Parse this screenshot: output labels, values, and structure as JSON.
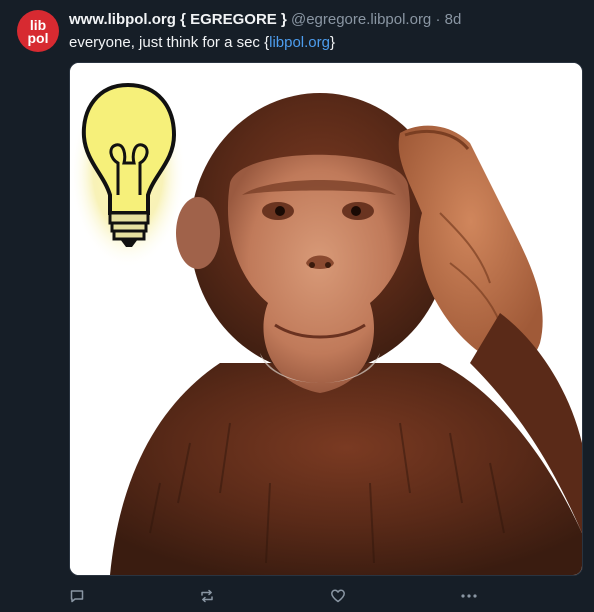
{
  "post": {
    "author": {
      "display_name": "www.libpol.org { EGREGORE }",
      "handle": "@egregore.libpol.org",
      "avatar_text_top": "lib",
      "avatar_text_bottom": "pol"
    },
    "separator": "·",
    "age": "8d",
    "text_prefix": "everyone, just think for a sec {",
    "link_text": "libpol.org",
    "text_suffix": "}",
    "media": {
      "description_icon": "chimp-thinking-lightbulb-image"
    },
    "actions": [
      {
        "name": "reply",
        "icon": "speech-bubble-icon"
      },
      {
        "name": "repost",
        "icon": "repost-icon"
      },
      {
        "name": "like",
        "icon": "heart-icon"
      },
      {
        "name": "more",
        "icon": "ellipsis-icon"
      }
    ]
  },
  "colors": {
    "background": "#161e27",
    "text": "#f1f3f5",
    "muted": "#8a96a3",
    "link": "#4d9dee",
    "avatar_bg": "#d72a31"
  }
}
